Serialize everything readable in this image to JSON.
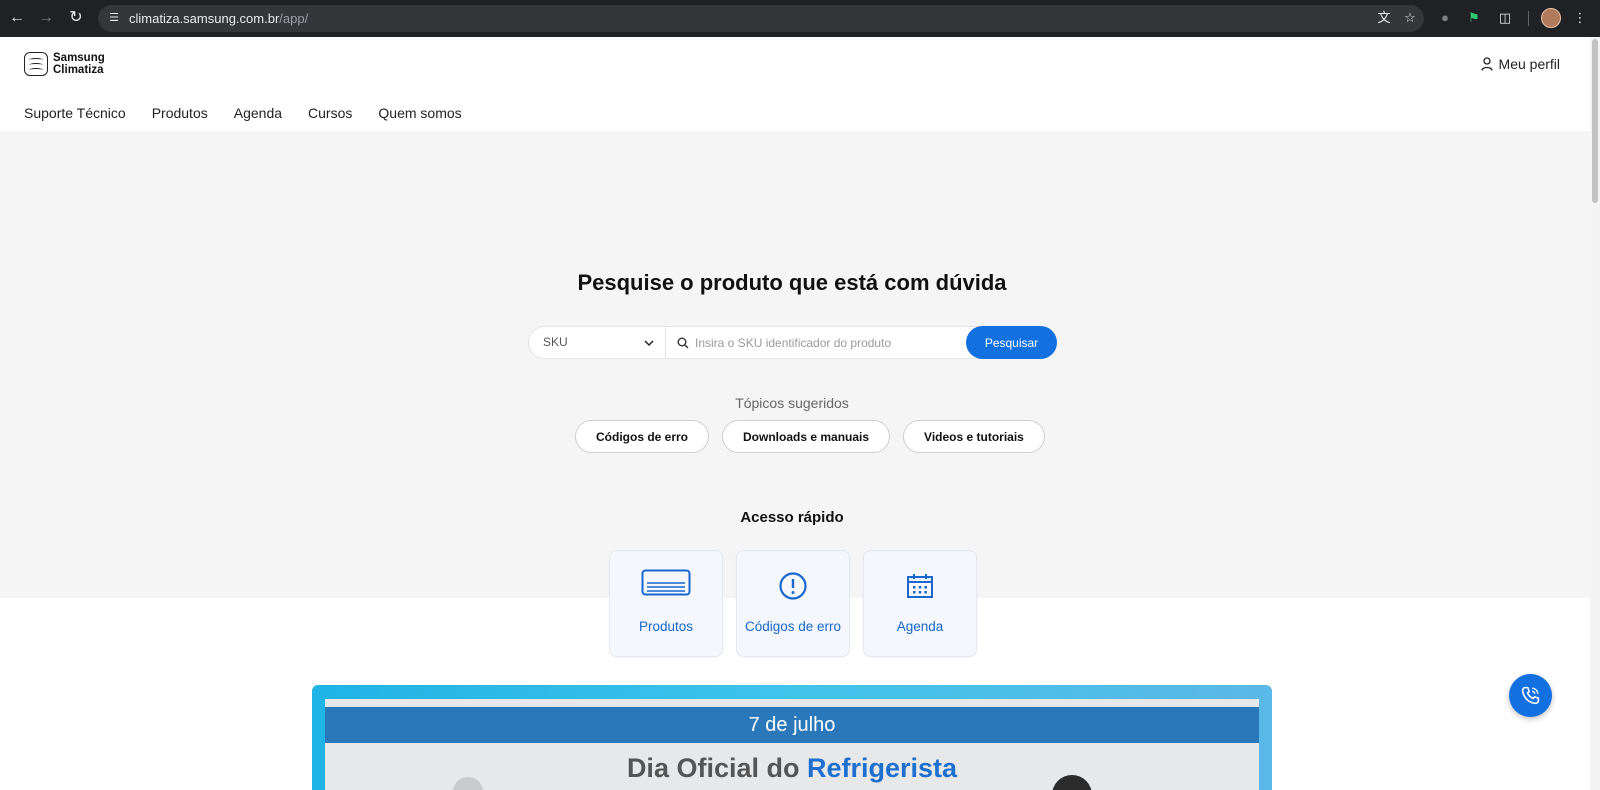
{
  "browser": {
    "url_host": "climatiza.samsung.com.br",
    "url_path": "/app/",
    "back_icon": "arrow-left",
    "forward_icon": "arrow-right",
    "reload_icon": "reload",
    "translate_icon": "translate",
    "star_icon": "star",
    "extensions_icon": "puzzle-piece",
    "menu_icon": "kebab-vertical"
  },
  "header": {
    "logo_line1": "Samsung",
    "logo_line2": "Climatiza",
    "profile_label": "Meu perfil",
    "nav": [
      {
        "label": "Suporte Técnico"
      },
      {
        "label": "Produtos"
      },
      {
        "label": "Agenda"
      },
      {
        "label": "Cursos"
      },
      {
        "label": "Quem somos"
      }
    ]
  },
  "hero": {
    "title": "Pesquise o produto que está com dúvida",
    "select_value": "SKU",
    "search_placeholder": "Insira o SKU identificador do produto",
    "search_button": "Pesquisar",
    "topics_label": "Tópicos sugeridos",
    "topics": [
      {
        "label": "Códigos de erro"
      },
      {
        "label": "Downloads e manuais"
      },
      {
        "label": "Videos e tutoriais"
      }
    ],
    "quick_access_title": "Acesso rápido",
    "quick_access": [
      {
        "label": "Produtos",
        "icon": "air-conditioner-icon"
      },
      {
        "label": "Códigos de erro",
        "icon": "exclamation-circle-icon"
      },
      {
        "label": "Agenda",
        "icon": "calendar-icon"
      }
    ]
  },
  "banner": {
    "date": "7 de julho",
    "headline_prefix": "Dia Oficial do ",
    "headline_accent": "Refrigerista"
  },
  "colors": {
    "accent": "#1370e0",
    "link_blue": "#1767cf",
    "hero_bg": "#f5f5f5",
    "banner_bar": "#2a77b9"
  }
}
